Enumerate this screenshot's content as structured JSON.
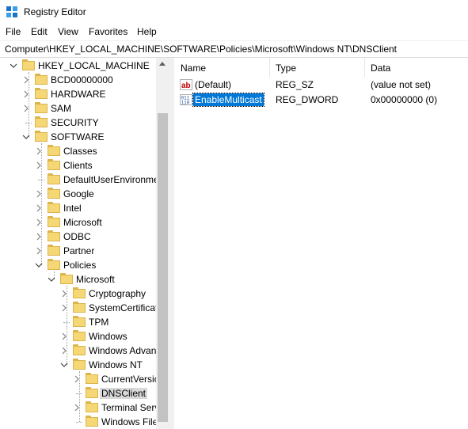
{
  "window": {
    "title": "Registry Editor"
  },
  "menu": [
    "File",
    "Edit",
    "View",
    "Favorites",
    "Help"
  ],
  "address": "Computer\\HKEY_LOCAL_MACHINE\\SOFTWARE\\Policies\\Microsoft\\Windows NT\\DNSClient",
  "tree": [
    {
      "label": "HKEY_LOCAL_MACHINE",
      "level": 0,
      "expanded": true
    },
    {
      "label": "BCD00000000",
      "level": 1,
      "expandable": true
    },
    {
      "label": "HARDWARE",
      "level": 1,
      "expandable": true
    },
    {
      "label": "SAM",
      "level": 1,
      "expandable": true
    },
    {
      "label": "SECURITY",
      "level": 1,
      "expandable": false
    },
    {
      "label": "SOFTWARE",
      "level": 1,
      "expanded": true
    },
    {
      "label": "Classes",
      "level": 2,
      "expandable": true
    },
    {
      "label": "Clients",
      "level": 2,
      "expandable": true
    },
    {
      "label": "DefaultUserEnvironmen",
      "level": 2,
      "expandable": false
    },
    {
      "label": "Google",
      "level": 2,
      "expandable": true
    },
    {
      "label": "Intel",
      "level": 2,
      "expandable": true
    },
    {
      "label": "Microsoft",
      "level": 2,
      "expandable": true
    },
    {
      "label": "ODBC",
      "level": 2,
      "expandable": true
    },
    {
      "label": "Partner",
      "level": 2,
      "expandable": true
    },
    {
      "label": "Policies",
      "level": 2,
      "expanded": true
    },
    {
      "label": "Microsoft",
      "level": 3,
      "expanded": true
    },
    {
      "label": "Cryptography",
      "level": 4,
      "expandable": true
    },
    {
      "label": "SystemCertificate",
      "level": 4,
      "expandable": true
    },
    {
      "label": "TPM",
      "level": 4,
      "expandable": false
    },
    {
      "label": "Windows",
      "level": 4,
      "expandable": true
    },
    {
      "label": "Windows Advanc",
      "level": 4,
      "expandable": true
    },
    {
      "label": "Windows NT",
      "level": 4,
      "expanded": true
    },
    {
      "label": "CurrentVersion",
      "level": 5,
      "expandable": true
    },
    {
      "label": "DNSClient",
      "level": 5,
      "expandable": false,
      "selected": true
    },
    {
      "label": "Terminal Servi",
      "level": 5,
      "expandable": true
    },
    {
      "label": "Windows File",
      "level": 5,
      "expandable": false
    }
  ],
  "list": {
    "headers": {
      "name": "Name",
      "type": "Type",
      "data": "Data"
    },
    "rows": [
      {
        "icon": "string-value-icon",
        "name": "(Default)",
        "type": "REG_SZ",
        "data": "(value not set)",
        "selected": false
      },
      {
        "icon": "dword-value-icon",
        "name": "EnableMulticast",
        "type": "REG_DWORD",
        "data": "0x00000000 (0)",
        "selected": true
      }
    ]
  },
  "colors": {
    "selection": "#0078d7",
    "folder": "#f6d776",
    "tree_selected": "#d9d9d9"
  }
}
